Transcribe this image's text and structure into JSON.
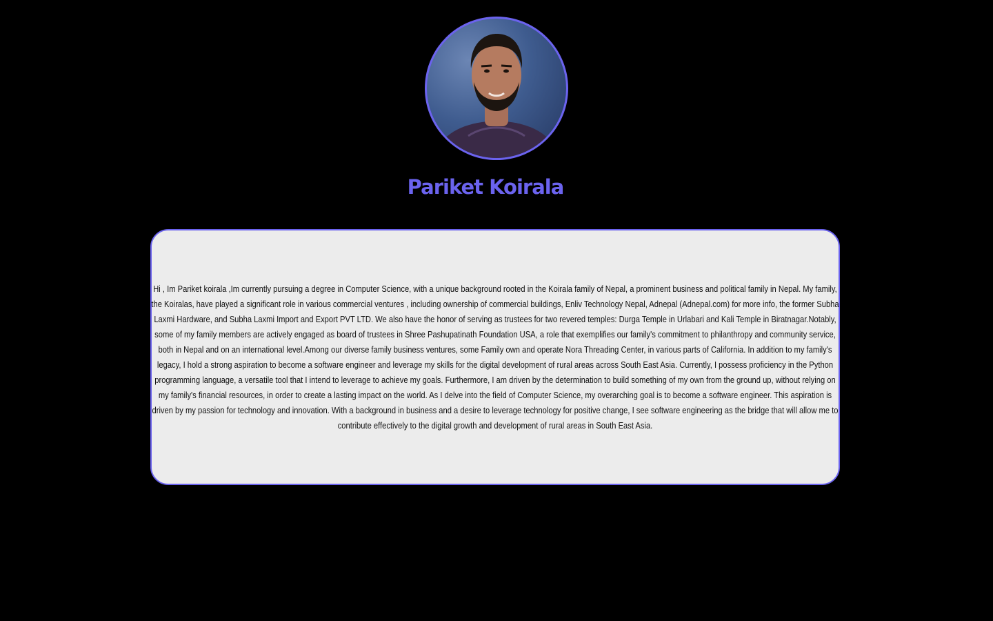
{
  "profile": {
    "name": "Pariket Koirala",
    "avatar_alt": "profile photo",
    "bio": "Hi , Im Pariket koirala ,Im currently pursuing a degree in Computer Science, with a unique background rooted in the Koirala family of Nepal, a prominent business and political family in Nepal. My family, the Koiralas, have played a significant role in various commercial ventures , including ownership of commercial buildings, Enliv Technology Nepal, Adnepal (Adnepal.com) for more info, the former Subha Laxmi Hardware, and Subha Laxmi Import and Export PVT LTD. We also have the honor of serving as trustees for two revered temples: Durga Temple in Urlabari and Kali Temple in Biratnagar.Notably, some of my family members are actively engaged as board of trustees in Shree Pashupatinath Foundation USA, a role that exemplifies our family's commitment to philanthropy and community service, both in Nepal and on an international level.Among our diverse family business ventures, some Family own and operate Nora Threading Center, in various parts of California. In addition to my family's legacy, I hold a strong aspiration to become a software engineer and leverage my skills for the digital development of rural areas across South East Asia. Currently, I possess proficiency in the Python programming language, a versatile tool that I intend to leverage to achieve my goals. Furthermore, I am driven by the determination to build something of my own from the ground up, without relying on my family's financial resources, in order to create a lasting impact on the world. As I delve into the field of Computer Science, my overarching goal is to become a software engineer. This aspiration is driven by my passion for technology and innovation. With a background in business and a desire to leverage technology for positive change, I see software engineering as the bridge that will allow me to contribute effectively to the digital growth and development of rural areas in South East Asia."
  },
  "colors": {
    "background": "#000000",
    "accent": "#6b63ee",
    "card": "#ececec",
    "text": "#111111"
  }
}
